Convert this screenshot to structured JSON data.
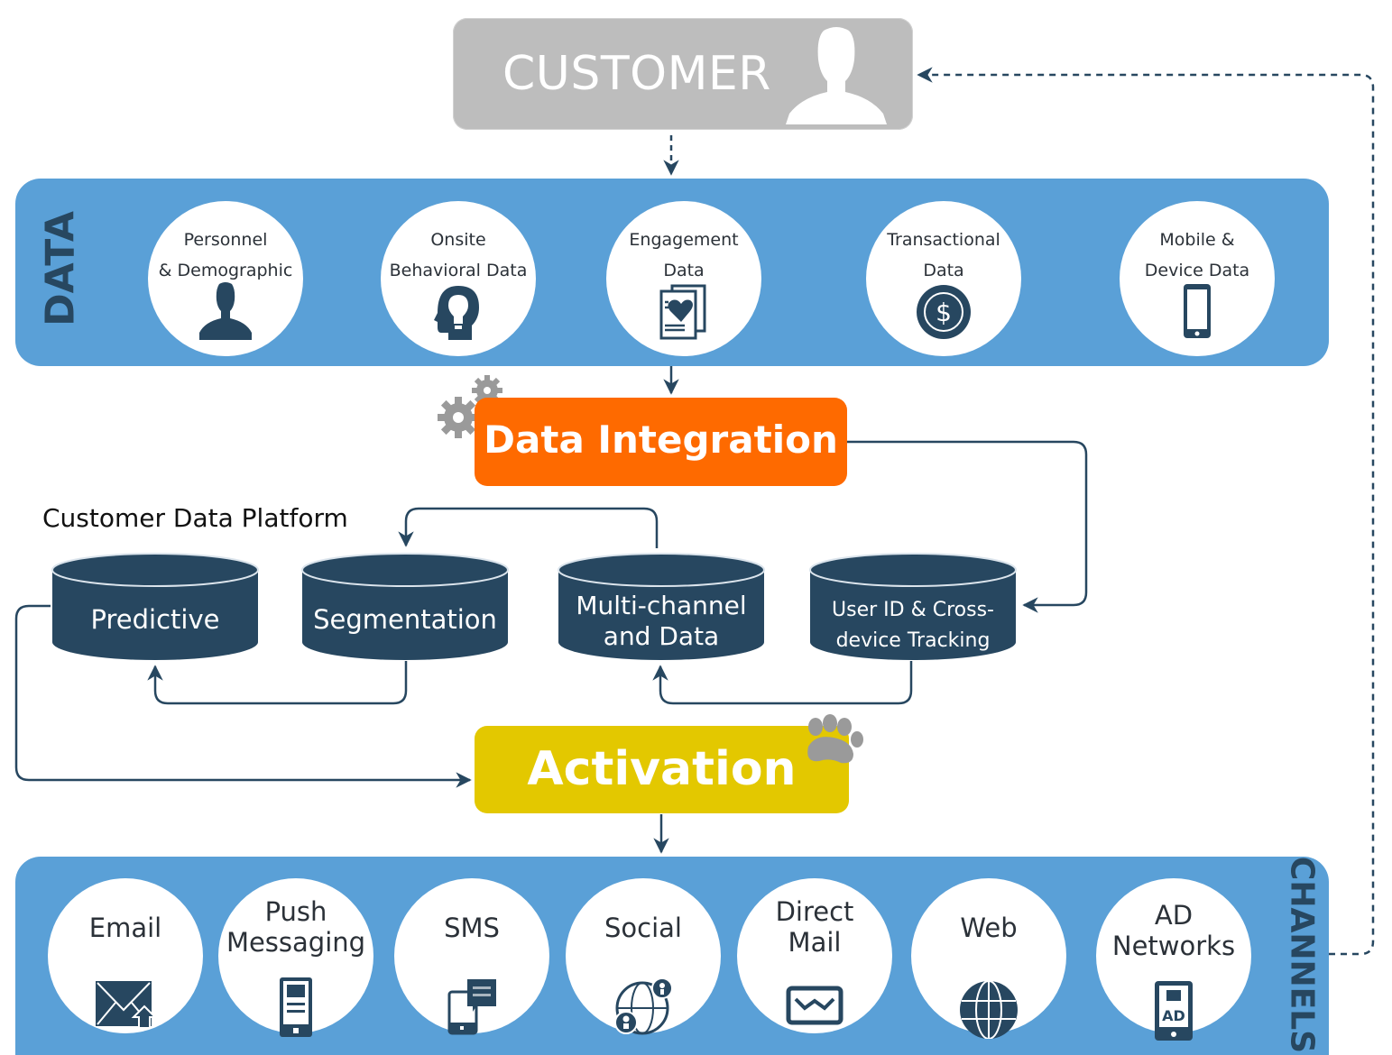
{
  "customer": {
    "label": "CUSTOMER",
    "icon": "person-icon"
  },
  "data_section": {
    "title": "DATA",
    "items": [
      {
        "lines": [
          "Personnel",
          "& Demographic"
        ],
        "icon": "person-icon"
      },
      {
        "lines": [
          "Onsite",
          "Behavioral Data"
        ],
        "icon": "head-lightbulb-icon"
      },
      {
        "lines": [
          "Engagement",
          "Data"
        ],
        "icon": "document-heart-icon"
      },
      {
        "lines": [
          "Transactional",
          "Data"
        ],
        "icon": "dollar-coin-icon"
      },
      {
        "lines": [
          "Mobile &",
          "Device Data"
        ],
        "icon": "smartphone-icon"
      }
    ]
  },
  "integration": {
    "label": "Data Integration",
    "icon": "gears-icon"
  },
  "cdp": {
    "title": "Customer Data Platform",
    "stores": [
      {
        "lines": [
          "Predictive"
        ]
      },
      {
        "lines": [
          "Segmentation"
        ]
      },
      {
        "lines": [
          "Multi-channel",
          "and Data"
        ]
      },
      {
        "lines": [
          "User ID & Cross-",
          "device Tracking"
        ]
      }
    ]
  },
  "activation": {
    "label": "Activation",
    "icon": "paw-print-icon"
  },
  "channels_section": {
    "title": "CHANNELS",
    "items": [
      {
        "lines": [
          "Email"
        ],
        "icon": "email-icon"
      },
      {
        "lines": [
          "Push",
          "Messaging"
        ],
        "icon": "mobile-notification-icon"
      },
      {
        "lines": [
          "SMS"
        ],
        "icon": "sms-chat-icon"
      },
      {
        "lines": [
          "Social"
        ],
        "icon": "social-globe-icon"
      },
      {
        "lines": [
          "Direct",
          "Mail"
        ],
        "icon": "envelope-icon"
      },
      {
        "lines": [
          "Web"
        ],
        "icon": "globe-icon"
      },
      {
        "lines": [
          "AD",
          "Networks"
        ],
        "icon": "mobile-ad-icon"
      }
    ]
  },
  "colors": {
    "band": "#5aa0d7",
    "navy": "#274760",
    "integration": "#fe6a00",
    "activation": "#e3c800",
    "customer": "#bdbdbd",
    "gear": "#9a9a9a"
  }
}
